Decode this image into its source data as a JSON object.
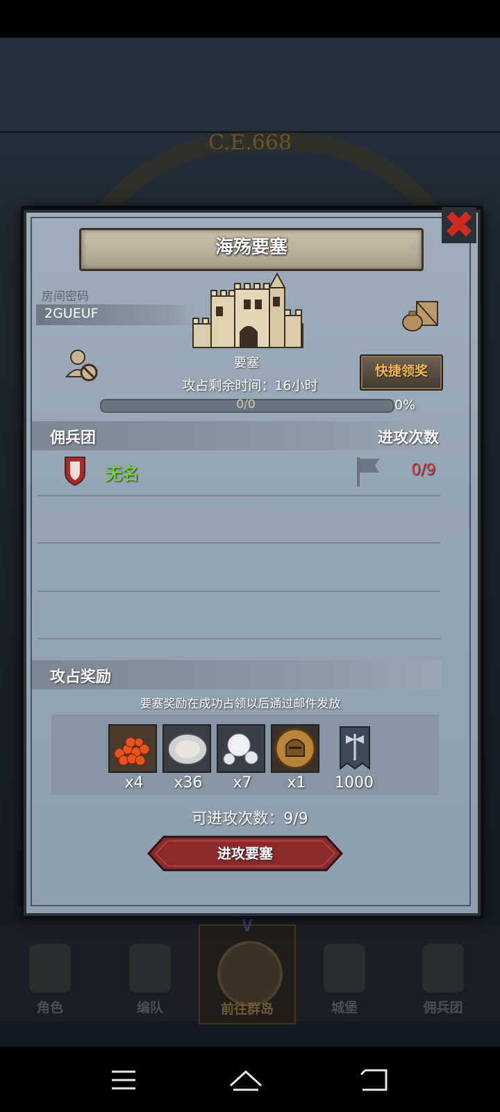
{
  "background": {
    "era_text": "C.E.668"
  },
  "modal": {
    "title": "海殇要塞",
    "room_label": "房间密码",
    "room_code": "2GUEUF",
    "fortress_name": "要塞",
    "quick_claim_label": "快捷领奖",
    "remaining_time_text": "攻占剩余时间：16小时",
    "progress": {
      "text": "0/0",
      "percent_label": "0%",
      "fraction": 0
    },
    "mercenary_section": {
      "left_header": "佣兵团",
      "right_header": "进攻次数",
      "rows": [
        {
          "name": "无名",
          "attacks": "0/9"
        }
      ]
    },
    "reward_section": {
      "header": "攻占奖励",
      "note": "要塞奖励在成功占领以后通过邮件发放",
      "items": [
        {
          "icon": "salmon-roe-icon",
          "count": "x4"
        },
        {
          "icon": "oyster-icon",
          "count": "x36"
        },
        {
          "icon": "pearl-icon",
          "count": "x7"
        },
        {
          "icon": "knight-helmet-coin-icon",
          "count": "x1"
        },
        {
          "icon": "axe-banner-icon",
          "count": "1000"
        }
      ]
    },
    "attacks_available_text": "可进攻次数：9/9",
    "attack_button_label": "进攻要塞"
  },
  "bottom_nav": {
    "items": [
      {
        "label": "角色",
        "icon": "character-icon"
      },
      {
        "label": "编队",
        "icon": "formation-icon"
      },
      {
        "label": "前往群岛",
        "icon": "globe-icon",
        "active": true
      },
      {
        "label": "城堡",
        "icon": "castle-icon"
      },
      {
        "label": "佣兵团",
        "icon": "mercenary-icon"
      }
    ]
  },
  "colors": {
    "merc_name": "#72d33b",
    "attack_count": "#d5394a",
    "quick_claim_text": "#f1b64a",
    "close_x": "#d22a1f",
    "attack_button": "#8a2a2c"
  }
}
